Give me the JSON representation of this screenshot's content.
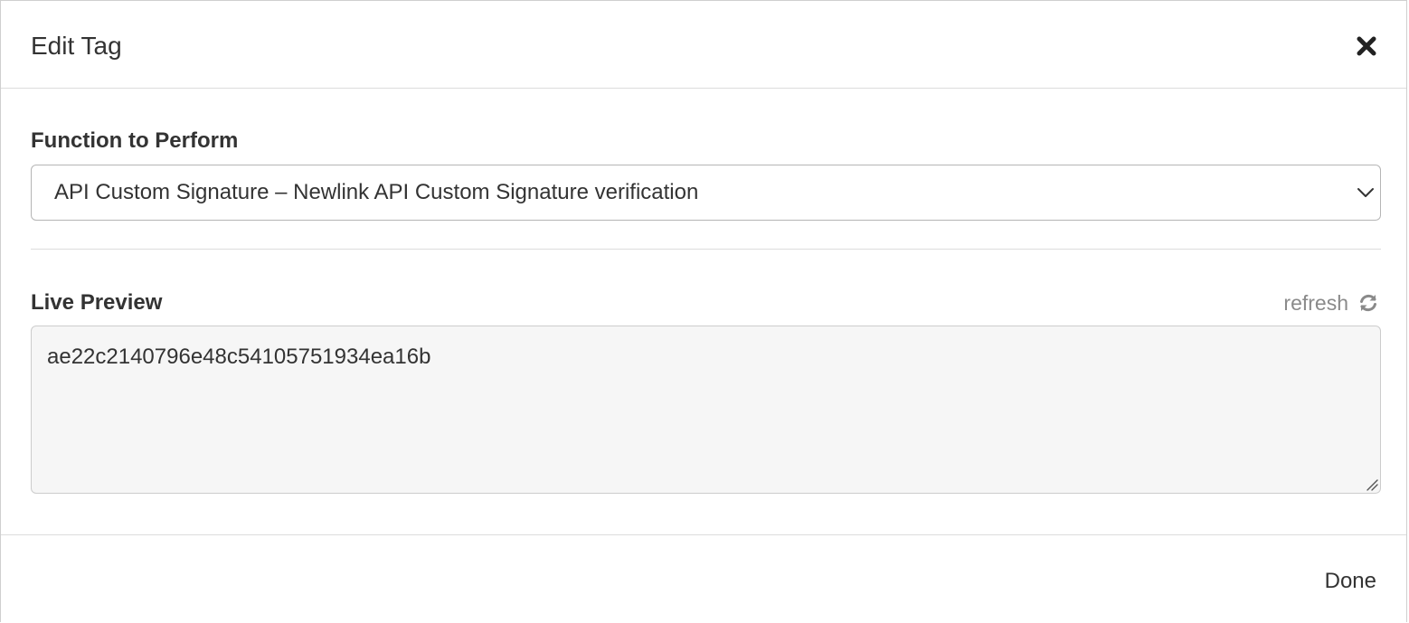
{
  "modal": {
    "title": "Edit Tag",
    "close_icon": "close-icon"
  },
  "function_field": {
    "label": "Function to Perform",
    "selected_value": "API Custom Signature – Newlink API Custom Signature verification",
    "chevron_icon": "chevron-down-icon"
  },
  "preview": {
    "label": "Live Preview",
    "refresh_label": "refresh",
    "refresh_icon": "refresh-icon",
    "value": "ae22c2140796e48c54105751934ea16b"
  },
  "footer": {
    "done_label": "Done"
  },
  "colors": {
    "text": "#333333",
    "muted": "#8a8a8a",
    "border": "#b5b5b5",
    "preview_bg": "#f6f6f6"
  }
}
